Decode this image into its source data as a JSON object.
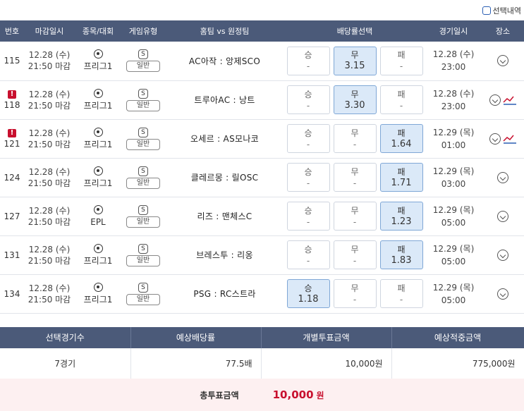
{
  "top": {
    "selection_label": "선택내역"
  },
  "headers": {
    "no": "번호",
    "deadline": "마감일시",
    "sport": "종목/대회",
    "game_type": "게임유형",
    "teams": "홈팀 vs 원정팀",
    "odds": "배당률선택",
    "game_date": "경기일시",
    "place": "장소"
  },
  "rows": [
    {
      "no": "115",
      "alert": "",
      "deadline_date": "12.28 (수)",
      "deadline_time": "21:50 마감",
      "league": "프리그1",
      "s": "S",
      "type": "일반",
      "teams": "AC아작 : 앙제SCO",
      "win_label": "승",
      "win_val": "-",
      "draw_label": "무",
      "draw_val": "3.15",
      "lose_label": "패",
      "lose_val": "-",
      "sel": "draw",
      "game_date": "12.28 (수)",
      "game_time": "23:00",
      "trend": false
    },
    {
      "no": "118",
      "alert": "!",
      "deadline_date": "12.28 (수)",
      "deadline_time": "21:50 마감",
      "league": "프리그1",
      "s": "S",
      "type": "일반",
      "teams": "트루아AC : 낭트",
      "win_label": "승",
      "win_val": "-",
      "draw_label": "무",
      "draw_val": "3.30",
      "lose_label": "패",
      "lose_val": "-",
      "sel": "draw",
      "game_date": "12.28 (수)",
      "game_time": "23:00",
      "trend": true
    },
    {
      "no": "121",
      "alert": "!",
      "deadline_date": "12.28 (수)",
      "deadline_time": "21:50 마감",
      "league": "프리그1",
      "s": "S",
      "type": "일반",
      "teams": "오세르 : AS모나코",
      "win_label": "승",
      "win_val": "-",
      "draw_label": "무",
      "draw_val": "-",
      "lose_label": "패",
      "lose_val": "1.64",
      "sel": "lose",
      "game_date": "12.29 (목)",
      "game_time": "01:00",
      "trend": true
    },
    {
      "no": "124",
      "alert": "",
      "deadline_date": "12.28 (수)",
      "deadline_time": "21:50 마감",
      "league": "프리그1",
      "s": "S",
      "type": "일반",
      "teams": "클레르몽 : 릴OSC",
      "win_label": "승",
      "win_val": "-",
      "draw_label": "무",
      "draw_val": "-",
      "lose_label": "패",
      "lose_val": "1.71",
      "sel": "lose",
      "game_date": "12.29 (목)",
      "game_time": "03:00",
      "trend": false
    },
    {
      "no": "127",
      "alert": "",
      "deadline_date": "12.28 (수)",
      "deadline_time": "21:50 마감",
      "league": "EPL",
      "s": "S",
      "type": "일반",
      "teams": "리즈 : 맨체스C",
      "win_label": "승",
      "win_val": "-",
      "draw_label": "무",
      "draw_val": "-",
      "lose_label": "패",
      "lose_val": "1.23",
      "sel": "lose",
      "game_date": "12.29 (목)",
      "game_time": "05:00",
      "trend": false
    },
    {
      "no": "131",
      "alert": "",
      "deadline_date": "12.28 (수)",
      "deadline_time": "21:50 마감",
      "league": "프리그1",
      "s": "S",
      "type": "일반",
      "teams": "브레스투 : 리옹",
      "win_label": "승",
      "win_val": "-",
      "draw_label": "무",
      "draw_val": "-",
      "lose_label": "패",
      "lose_val": "1.83",
      "sel": "lose",
      "game_date": "12.29 (목)",
      "game_time": "05:00",
      "trend": false
    },
    {
      "no": "134",
      "alert": "",
      "deadline_date": "12.28 (수)",
      "deadline_time": "21:50 마감",
      "league": "프리그1",
      "s": "S",
      "type": "일반",
      "teams": "PSG : RC스트라",
      "win_label": "승",
      "win_val": "1.18",
      "draw_label": "무",
      "draw_val": "-",
      "lose_label": "패",
      "lose_val": "-",
      "sel": "win",
      "game_date": "12.29 (목)",
      "game_time": "05:00",
      "trend": false
    }
  ],
  "summary": {
    "headers": [
      "선택경기수",
      "예상배당률",
      "개별투표금액",
      "예상적중금액"
    ],
    "values": [
      "7경기",
      "77.5배",
      "10,000원",
      "775,000원"
    ]
  },
  "total": {
    "label": "총투표금액",
    "amount": "10,000",
    "unit": "원"
  },
  "colors": {
    "header_bg": "#4b5a79",
    "selected_bg": "#dbe9f8",
    "alert_red": "#c8102e",
    "total_bg": "#fdf0f1"
  }
}
